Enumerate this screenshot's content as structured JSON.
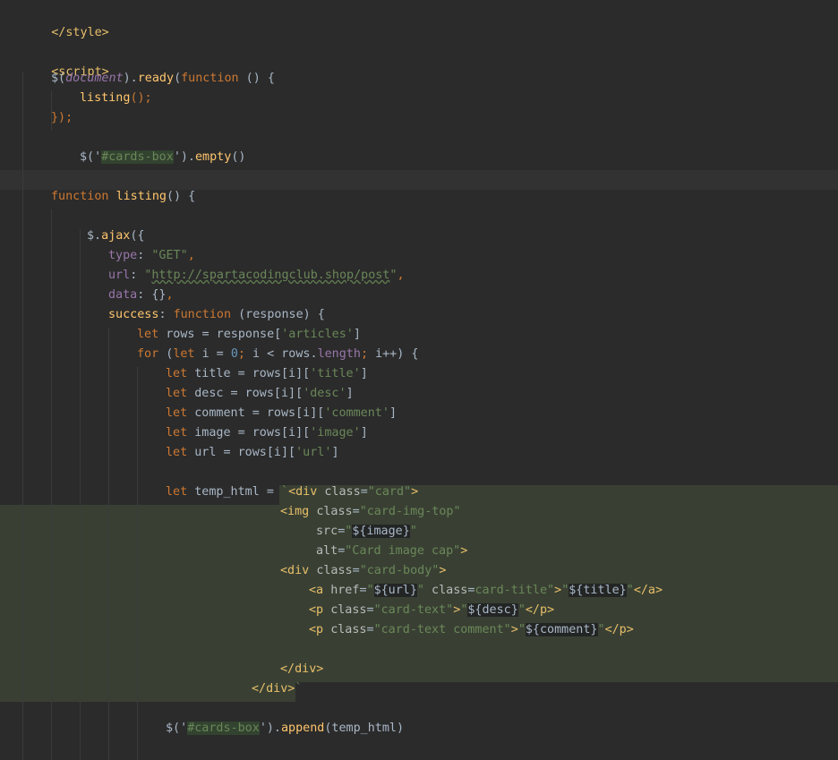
{
  "editor": {
    "language": "html/javascript",
    "theme_background": "#2b2b2b",
    "template_highlight": "#394033",
    "lines": {
      "l1": "</style>",
      "l3": "<script>",
      "l4_a": "$(",
      "l4_b": "document",
      "l4_c": ").",
      "l4_d": "ready",
      "l4_e": "(",
      "l4_f": "function",
      "l4_g": " () {",
      "l5_a": "listing",
      "l5_b": "();",
      "l6": "});",
      "l8_a": "$('",
      "l8_b": "#cards-box",
      "l8_c": "').",
      "l8_d": "empty",
      "l8_e": "()",
      "l10_a": "function ",
      "l10_b": "listing",
      "l10_c": "() {",
      "l12_a": "$.",
      "l12_b": "ajax",
      "l12_c": "({",
      "l13_a": "type",
      "l13_b": ": ",
      "l13_c": "\"GET\"",
      "l13_d": ",",
      "l14_a": "url",
      "l14_b": ": ",
      "l14_c": "\"",
      "l14_d": "http://spartacodingclub.shop/post",
      "l14_e": "\"",
      "l14_f": ",",
      "l15_a": "data",
      "l15_b": ": {}",
      "l15_c": ",",
      "l16_a": "success",
      "l16_b": ": ",
      "l16_c": "function ",
      "l16_d": "(response) {",
      "l17_a": "let ",
      "l17_b": "rows = response[",
      "l17_c": "'articles'",
      "l17_d": "]",
      "l18_a": "for ",
      "l18_b": "(",
      "l18_c": "let ",
      "l18_d": "i = ",
      "l18_e": "0",
      "l18_f": "; ",
      "l18_g": "i < rows.",
      "l18_h": "length",
      "l18_i": "; ",
      "l18_j": "i++) {",
      "l19_a": "let ",
      "l19_b": "title = rows[i][",
      "l19_c": "'title'",
      "l19_d": "]",
      "l20_a": "let ",
      "l20_b": "desc = rows[i][",
      "l20_c": "'desc'",
      "l20_d": "]",
      "l21_a": "let ",
      "l21_b": "comment = rows[i][",
      "l21_c": "'comment'",
      "l21_d": "]",
      "l22_a": "let ",
      "l22_b": "image = rows[i][",
      "l22_c": "'image'",
      "l22_d": "]",
      "l23_a": "let ",
      "l23_b": "url = rows[i][",
      "l23_c": "'url'",
      "l23_d": "]",
      "l25_a": "let ",
      "l25_b": "temp_html = ",
      "l25_c": "`",
      "l25_d": "<div ",
      "l25_e": "class",
      "l25_f": "=",
      "l25_g": "\"card\"",
      "l25_h": ">",
      "l26_a": "<img ",
      "l26_b": "class",
      "l26_c": "=",
      "l26_d": "\"card-img-top\"",
      "l27_a": "src",
      "l27_b": "=",
      "l27_c": "\"",
      "l27_d": "${image}",
      "l27_e": "\"",
      "l28_a": "alt",
      "l28_b": "=",
      "l28_c": "\"Card image cap\"",
      "l28_d": ">",
      "l29_a": "<div ",
      "l29_b": "class",
      "l29_c": "=",
      "l29_d": "\"card-body\"",
      "l29_e": ">",
      "l30_a": "<a ",
      "l30_b": "href",
      "l30_c": "=",
      "l30_d": "\"",
      "l30_e": "${url}",
      "l30_f": "\"",
      "l30_g": " class",
      "l30_h": "=",
      "l30_i": "card-title\"",
      "l30_j": ">",
      "l30_k": "\"",
      "l30_l": "${title}",
      "l30_m": "\"",
      "l30_n": "</a>",
      "l31_a": "<p ",
      "l31_b": "class",
      "l31_c": "=",
      "l31_d": "\"card-text\"",
      "l31_e": ">",
      "l31_f": "\"",
      "l31_g": "${desc}",
      "l31_h": "\"",
      "l31_i": "</p>",
      "l32_a": "<p ",
      "l32_b": "class",
      "l32_c": "=",
      "l32_d": "\"card-text comment\"",
      "l32_e": ">",
      "l32_f": "\"",
      "l32_g": "${comment}",
      "l32_h": "\"",
      "l32_i": "</p>",
      "l34": "</div>",
      "l35_a": "</div>",
      "l35_b": "`",
      "l37_a": "$('",
      "l37_b": "#cards-box",
      "l37_c": "').",
      "l37_d": "append",
      "l37_e": "(temp_html)"
    }
  }
}
